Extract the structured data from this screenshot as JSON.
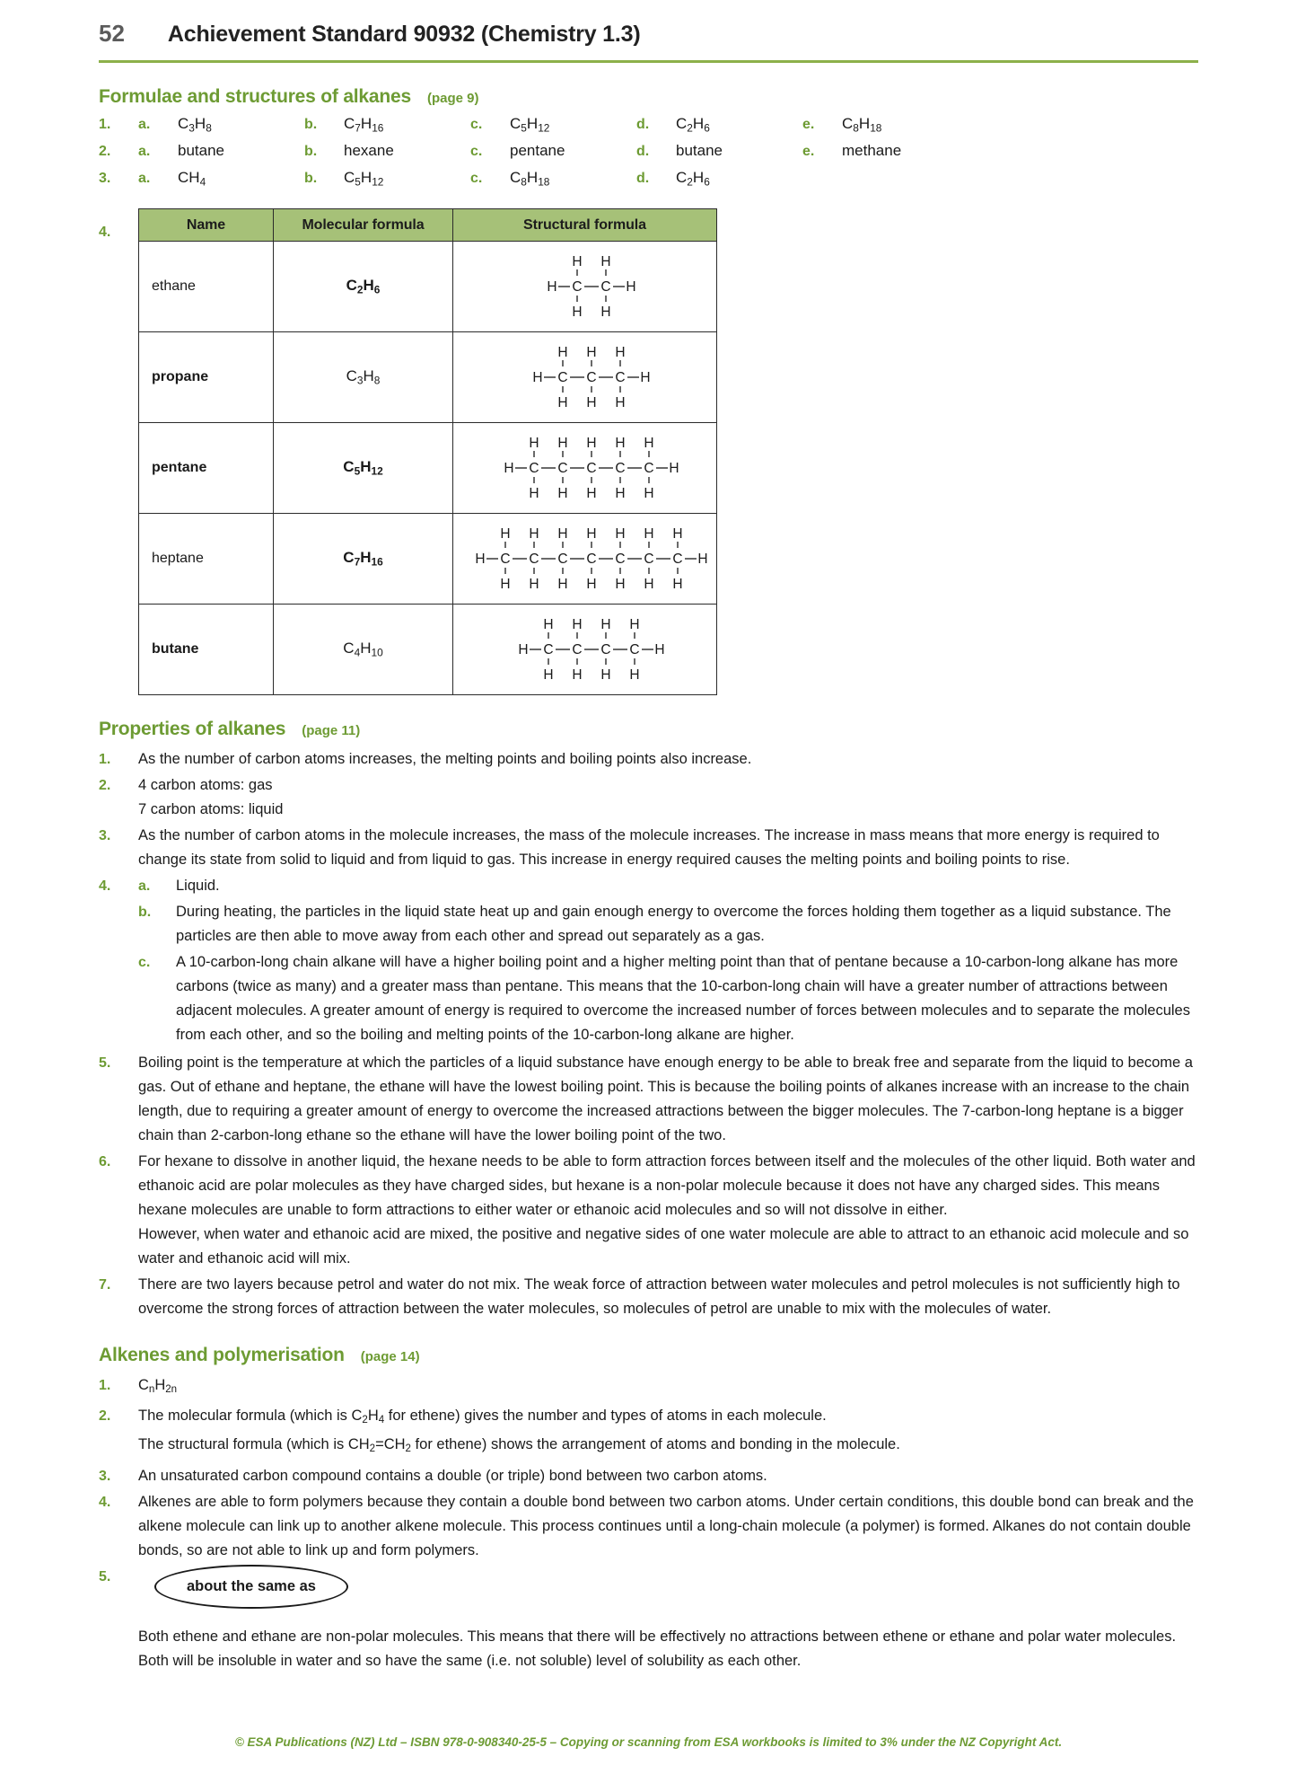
{
  "header": {
    "page_number": "52",
    "title": "Achievement Standard 90932 (Chemistry 1.3)"
  },
  "section_formulae": {
    "title": "Formulae and structures of alkanes",
    "page_ref": "(page 9)",
    "rows": [
      {
        "num": "1.",
        "items": [
          {
            "letter": "a.",
            "value": "C3H8"
          },
          {
            "letter": "b.",
            "value": "C7H16"
          },
          {
            "letter": "c.",
            "value": "C5H12"
          },
          {
            "letter": "d.",
            "value": "C2H6"
          },
          {
            "letter": "e.",
            "value": "C8H18"
          }
        ]
      },
      {
        "num": "2.",
        "items": [
          {
            "letter": "a.",
            "value": "butane"
          },
          {
            "letter": "b.",
            "value": "hexane"
          },
          {
            "letter": "c.",
            "value": "pentane"
          },
          {
            "letter": "d.",
            "value": "butane"
          },
          {
            "letter": "e.",
            "value": "methane"
          }
        ]
      },
      {
        "num": "3.",
        "items": [
          {
            "letter": "a.",
            "value": "CH4"
          },
          {
            "letter": "b.",
            "value": "C5H12"
          },
          {
            "letter": "c.",
            "value": "C8H18"
          },
          {
            "letter": "d.",
            "value": "C2H6"
          }
        ]
      }
    ],
    "table": {
      "num": "4.",
      "headers": [
        "Name",
        "Molecular formula",
        "Structural formula"
      ],
      "rows": [
        {
          "name": "ethane",
          "name_bold": false,
          "formula": "C2H6",
          "formula_bold": true,
          "carbons": 2
        },
        {
          "name": "propane",
          "name_bold": true,
          "formula": "C3H8",
          "formula_bold": false,
          "carbons": 3
        },
        {
          "name": "pentane",
          "name_bold": true,
          "formula": "C5H12",
          "formula_bold": true,
          "carbons": 5
        },
        {
          "name": "heptane",
          "name_bold": false,
          "formula": "C7H16",
          "formula_bold": true,
          "carbons": 7
        },
        {
          "name": "butane",
          "name_bold": true,
          "formula": "C4H10",
          "formula_bold": false,
          "carbons": 4
        }
      ]
    }
  },
  "section_properties": {
    "title": "Properties of  alkanes",
    "page_ref": "(page 11)",
    "items": [
      {
        "num": "1.",
        "text": "As the number of carbon atoms increases, the melting points and boiling points also increase."
      },
      {
        "num": "2.",
        "lines": [
          "4 carbon atoms: gas",
          "7 carbon atoms: liquid"
        ]
      },
      {
        "num": "3.",
        "text": "As the number of carbon atoms in the molecule increases, the mass of the molecule increases. The increase in mass means that more energy is required to change its state from solid to liquid and from liquid to gas. This increase in energy required causes the melting points and boiling points to rise."
      },
      {
        "num": "4.",
        "subs": [
          {
            "letter": "a.",
            "text": "Liquid."
          },
          {
            "letter": "b.",
            "text": "During heating, the particles in the liquid state heat up and gain enough energy to overcome the forces holding them together as a liquid substance. The particles are then able to move away from each other and spread out separately as a gas."
          },
          {
            "letter": "c.",
            "text": "A 10-carbon-long chain alkane will have a higher boiling point and a higher melting point than that of pentane because a 10-carbon-long alkane has more carbons (twice as many) and a greater mass than pentane. This means that the 10-carbon-long chain will have a greater number of attractions between adjacent molecules. A greater amount of energy is required to overcome the increased number of forces between molecules and to separate the molecules from each other, and so the boiling and melting points of the 10-carbon-long alkane are higher."
          }
        ]
      },
      {
        "num": "5.",
        "text": "Boiling point is the temperature at which the particles of a liquid substance have enough energy to be able to break free and separate from the liquid to become a gas. Out of ethane and heptane, the ethane will have the lowest boiling point. This is because the boiling points of alkanes increase with an increase to the chain length, due to requiring a greater amount of energy to overcome the increased attractions between the bigger molecules. The 7-carbon-long heptane is a bigger chain than 2-carbon-long ethane so the ethane will have the lower boiling point of the two."
      },
      {
        "num": "6.",
        "lines": [
          "For hexane to dissolve in another liquid, the hexane needs to be able to form attraction forces between itself and the molecules of the other liquid. Both water and ethanoic acid are polar molecules as they have charged sides, but hexane is a non-polar molecule because it does not have any charged sides. This means hexane molecules are unable to form attractions to either water or ethanoic acid molecules and so will not dissolve in either.",
          "However, when water and ethanoic acid are mixed, the positive and negative sides of one water molecule are able to attract to an ethanoic acid molecule and so water and ethanoic acid will mix."
        ]
      },
      {
        "num": "7.",
        "text": "There are two layers because petrol and water do not mix. The weak force of attraction between water molecules and petrol molecules is not sufficiently high to overcome the strong forces of attraction between the water molecules, so molecules of petrol are unable to mix with the molecules of water."
      }
    ]
  },
  "section_alkenes": {
    "title": "Alkenes and polymerisation",
    "page_ref": "(page 14)",
    "items": [
      {
        "num": "1.",
        "html": "C<sub>n</sub>H<sub>2n</sub>"
      },
      {
        "num": "2.",
        "html_lines": [
          "The molecular formula (which is C<sub>2</sub>H<sub>4</sub> for ethene) gives the number and types of atoms in each molecule.",
          "The structural formula (which is CH<sub>2</sub>&#61;CH<sub>2</sub> for ethene) shows the arrangement of atoms and bonding in the molecule."
        ]
      },
      {
        "num": "3.",
        "text": "An unsaturated carbon compound contains a double (or triple) bond between two carbon atoms."
      },
      {
        "num": "4.",
        "text": "Alkenes are able to form polymers because they contain a double bond between two carbon atoms. Under certain conditions, this double bond can break and the alkene molecule can link up to another alkene molecule. This process continues until a long-chain molecule (a polymer) is formed. Alkanes do not contain double bonds, so are not able to link up and form polymers."
      },
      {
        "num": "5.",
        "ellipse_label": "about the same as",
        "text": "Both ethene and ethane are non-polar molecules. This means that there will be effectively no attractions between ethene or ethane and polar water molecules. Both will be insoluble in water and so have the same (i.e. not soluble) level of solubility as each other."
      }
    ]
  },
  "footer": {
    "text": "© ESA Publications (NZ) Ltd  –  ISBN 978-0-908340-25-5  –  Copying or scanning from ESA workbooks is limited to 3% under the NZ Copyright Act."
  },
  "colors": {
    "accent_green": "#6d9b33",
    "rule_green": "#8cb04a",
    "table_header_green": "#a6c178"
  }
}
